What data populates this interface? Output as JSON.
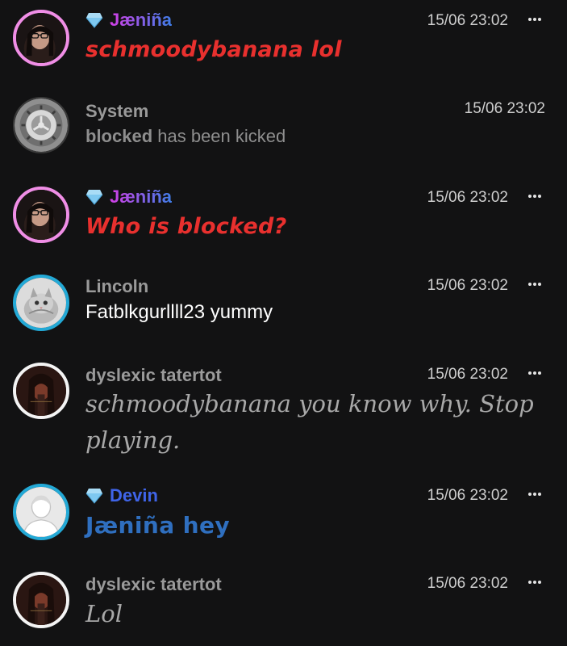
{
  "colors": {
    "background": "#121213",
    "red_text": "#e8302e",
    "blue_text": "#2f6fbf",
    "name_gradient_start": "#d33fe6",
    "name_gradient_end": "#3f7de8",
    "devin_name": "#3f64e8",
    "grey_name": "#9a9a9a",
    "pink_ring": "#f08ee6",
    "blue_ring": "#23a9d6"
  },
  "messages": [
    {
      "author": "Jæniña",
      "badge_icon": "diamond-icon",
      "time": "15/06 23:02",
      "text": "schmoodybanana lol"
    },
    {
      "author": "System",
      "time": "15/06 23:02",
      "text_bold": "blocked",
      "text_rest": " has been kicked"
    },
    {
      "author": "Jæniña",
      "badge_icon": "diamond-icon",
      "time": "15/06 23:02",
      "text": "Who is blocked?"
    },
    {
      "author": "Lincoln",
      "time": "15/06 23:02",
      "text": "Fatblkgurllll23 yummy"
    },
    {
      "author": "dyslexic tatertot",
      "time": "15/06 23:02",
      "text": "schmoodybanana you know why. Stop playing."
    },
    {
      "author": "Devin",
      "badge_icon": "diamond-icon",
      "time": "15/06 23:02",
      "text": "Jæniña hey"
    },
    {
      "author": "dyslexic tatertot",
      "time": "15/06 23:02",
      "text": "Lol"
    }
  ]
}
